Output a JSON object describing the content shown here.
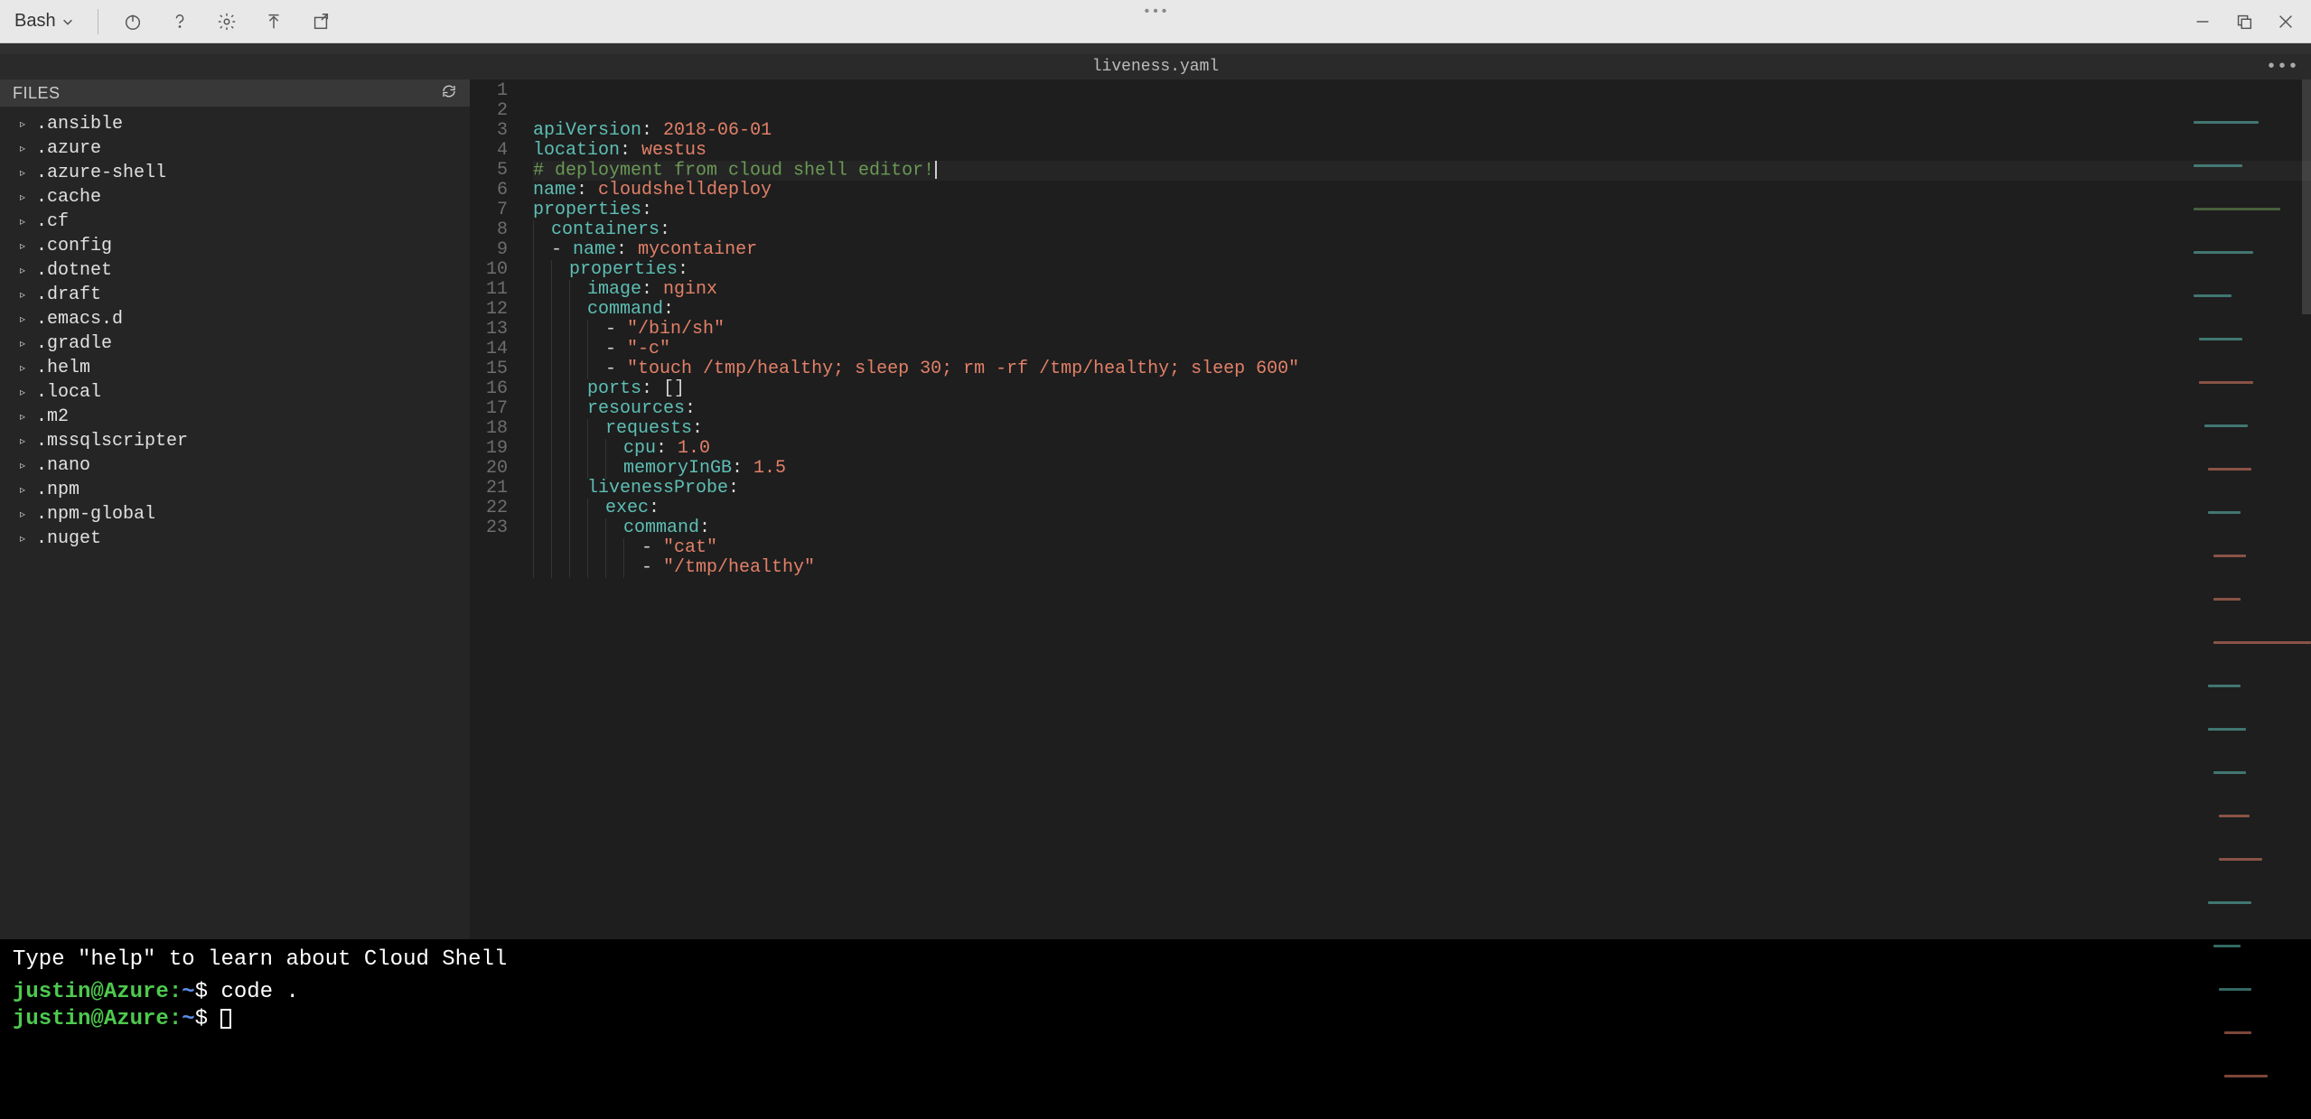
{
  "toolbar": {
    "shell": "Bash",
    "dots": "•••"
  },
  "editor": {
    "filename": "liveness.yaml",
    "more": "•••",
    "sidebar_title": "FILES"
  },
  "files": [
    ".ansible",
    ".azure",
    ".azure-shell",
    ".cache",
    ".cf",
    ".config",
    ".dotnet",
    ".draft",
    ".emacs.d",
    ".gradle",
    ".helm",
    ".local",
    ".m2",
    ".mssqlscripter",
    ".nano",
    ".npm",
    ".npm-global",
    ".nuget"
  ],
  "code": {
    "lines": [
      {
        "n": 1,
        "html": "<span class='tk-key'>apiVersion</span>: <span class='tk-str'>2018-06-01</span>"
      },
      {
        "n": 2,
        "html": "<span class='tk-key'>location</span>: <span class='tk-str'>westus</span>"
      },
      {
        "n": 3,
        "current": true,
        "html": "<span class='tk-comment'># deployment from cloud shell editor!</span><span class='cursor-caret'></span>"
      },
      {
        "n": 4,
        "html": "<span class='tk-key'>name</span>: <span class='tk-str'>cloudshelldeploy</span>"
      },
      {
        "n": 5,
        "html": "<span class='tk-key'>properties</span>:"
      },
      {
        "n": 6,
        "html": "<span class='indent'></span><span class='tk-key'>containers</span>:"
      },
      {
        "n": 7,
        "html": "<span class='indent'></span><span class='tk-dash'>-</span> <span class='tk-key'>name</span>: <span class='tk-str'>mycontainer</span>"
      },
      {
        "n": 8,
        "html": "<span class='indent'></span><span class='indent'></span><span class='tk-key'>properties</span>:"
      },
      {
        "n": 9,
        "html": "<span class='indent'></span><span class='indent'></span><span class='indent'></span><span class='tk-key'>image</span>: <span class='tk-str'>nginx</span>"
      },
      {
        "n": 10,
        "html": "<span class='indent'></span><span class='indent'></span><span class='indent'></span><span class='tk-key'>command</span>:"
      },
      {
        "n": 11,
        "html": "<span class='indent'></span><span class='indent'></span><span class='indent'></span><span class='indent'></span><span class='tk-dash'>-</span> <span class='tk-str'>\"/bin/sh\"</span>"
      },
      {
        "n": 12,
        "html": "<span class='indent'></span><span class='indent'></span><span class='indent'></span><span class='indent'></span><span class='tk-dash'>-</span> <span class='tk-str'>\"-c\"</span>"
      },
      {
        "n": 13,
        "html": "<span class='indent'></span><span class='indent'></span><span class='indent'></span><span class='indent'></span><span class='tk-dash'>-</span> <span class='tk-str'>\"touch /tmp/healthy; sleep 30; rm -rf /tmp/healthy; sleep 600\"</span>"
      },
      {
        "n": 14,
        "html": "<span class='indent'></span><span class='indent'></span><span class='indent'></span><span class='tk-key'>ports</span>: []"
      },
      {
        "n": 15,
        "html": "<span class='indent'></span><span class='indent'></span><span class='indent'></span><span class='tk-key'>resources</span>:"
      },
      {
        "n": 16,
        "html": "<span class='indent'></span><span class='indent'></span><span class='indent'></span><span class='indent'></span><span class='tk-key'>requests</span>:"
      },
      {
        "n": 17,
        "html": "<span class='indent'></span><span class='indent'></span><span class='indent'></span><span class='indent'></span><span class='indent'></span><span class='tk-key'>cpu</span>: <span class='tk-str'>1.0</span>"
      },
      {
        "n": 18,
        "html": "<span class='indent'></span><span class='indent'></span><span class='indent'></span><span class='indent'></span><span class='indent'></span><span class='tk-key'>memoryInGB</span>: <span class='tk-str'>1.5</span>"
      },
      {
        "n": 19,
        "html": "<span class='indent'></span><span class='indent'></span><span class='indent'></span><span class='tk-key'>livenessProbe</span>:"
      },
      {
        "n": 20,
        "html": "<span class='indent'></span><span class='indent'></span><span class='indent'></span><span class='indent'></span><span class='tk-key'>exec</span>:"
      },
      {
        "n": 21,
        "html": "<span class='indent'></span><span class='indent'></span><span class='indent'></span><span class='indent'></span><span class='indent'></span><span class='tk-key'>command</span>:"
      },
      {
        "n": 22,
        "html": "<span class='indent'></span><span class='indent'></span><span class='indent'></span><span class='indent'></span><span class='indent'></span><span class='indent'></span><span class='tk-dash'>-</span> <span class='tk-str'>\"cat\"</span>"
      },
      {
        "n": 23,
        "html": "<span class='indent'></span><span class='indent'></span><span class='indent'></span><span class='indent'></span><span class='indent'></span><span class='indent'></span><span class='tk-dash'>-</span> <span class='tk-str'>\"/tmp/healthy\"</span>"
      }
    ]
  },
  "terminal": {
    "hint": "Type \"help\" to learn about Cloud Shell",
    "user": "justin@Azure",
    "path": "~",
    "dollar": "$",
    "cmd1": "code ."
  }
}
